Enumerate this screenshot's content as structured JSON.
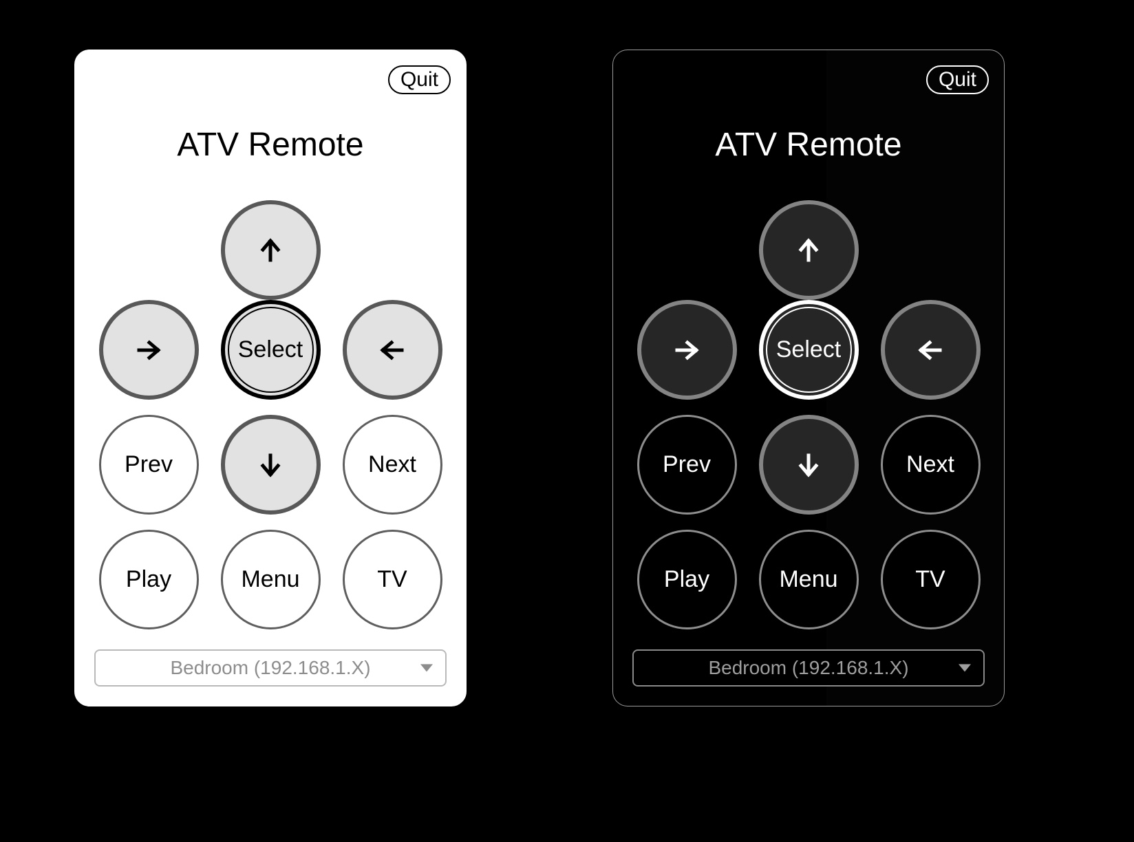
{
  "app": {
    "title": "ATV Remote",
    "quit_label": "Quit"
  },
  "panels": [
    {
      "theme": "light",
      "name": "light-theme-remote"
    },
    {
      "theme": "dark",
      "name": "dark-theme-remote"
    }
  ],
  "buttons": {
    "up": "up-arrow",
    "left": "left-arrow",
    "select": "Select",
    "right": "right-arrow",
    "prev": "Prev",
    "down": "down-arrow",
    "next": "Next",
    "play": "Play",
    "menu": "Menu",
    "tv": "TV"
  },
  "device_select": {
    "value": "Bedroom (192.168.1.X)",
    "chevron": "chevron-down-icon"
  },
  "colors": {
    "page_background": "#000000",
    "light_panel_bg": "#ffffff",
    "dark_panel_bg": "#000000",
    "light_dpad_fill": "#e2e2e2",
    "light_dpad_border": "#585858",
    "light_plain_border": "#5e5e5e",
    "dark_dpad_fill": "#262626",
    "dark_dpad_border": "#848484",
    "dark_plain_border": "#8e8e8e",
    "dropdown_text_light": "#8d8d8d",
    "dropdown_text_dark": "#9e9e9e"
  }
}
